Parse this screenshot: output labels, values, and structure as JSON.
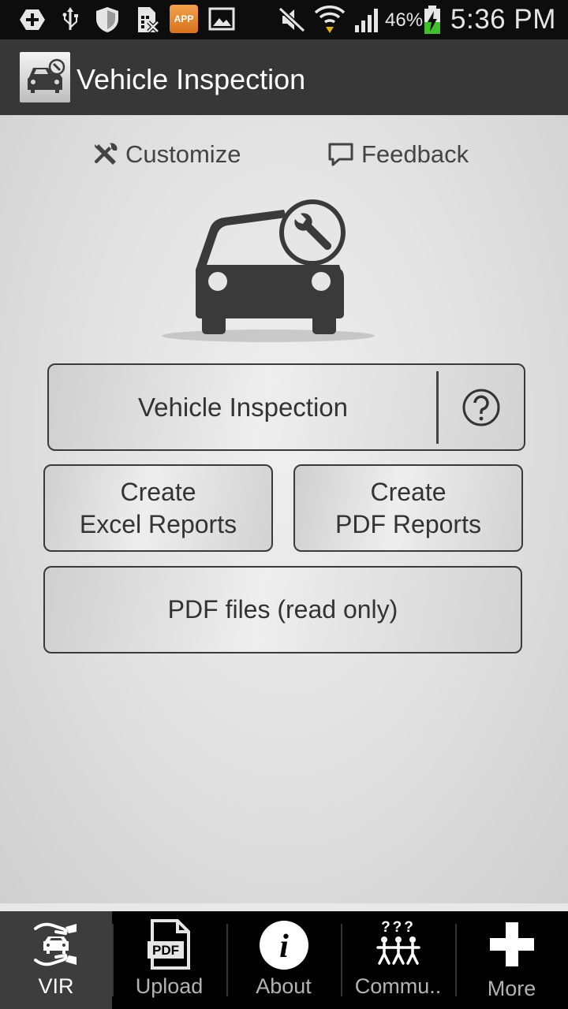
{
  "status_bar": {
    "battery_percent": "46%",
    "time": "5:36 PM",
    "icons": [
      "add-icon",
      "usb-icon",
      "shield-icon",
      "sim-icon",
      "app-icon",
      "image-icon",
      "mute-icon",
      "wifi-icon",
      "signal-icon",
      "battery-charging-icon"
    ],
    "app_icon_text": "APP"
  },
  "app_bar": {
    "title": "Vehicle Inspection",
    "logo_icon": "car-wrench-icon"
  },
  "links": {
    "customize": "Customize",
    "feedback": "Feedback"
  },
  "hero_icon": "car-wrench-icon",
  "buttons": {
    "vehicle_inspection": "Vehicle Inspection",
    "excel_line1": "Create",
    "excel_line2": "Excel Reports",
    "pdf_line1": "Create",
    "pdf_line2": "PDF Reports",
    "pdf_files": "PDF files (read only)",
    "help_icon": "question-icon"
  },
  "bottom_nav": {
    "items": [
      {
        "label": "VIR",
        "icon": "vir-hands-car-icon",
        "active": true
      },
      {
        "label": "Upload",
        "icon": "pdf-file-icon",
        "icon_text": "PDF"
      },
      {
        "label": "About",
        "icon": "info-icon",
        "icon_text": "i"
      },
      {
        "label": "Commu..",
        "icon": "community-icon",
        "icon_text": "???"
      },
      {
        "label": "More",
        "icon": "plus-icon"
      }
    ]
  },
  "colors": {
    "app_bar": "#373737",
    "status_bar": "#0d0d0d",
    "button_border": "#3a3a3a",
    "text_dark": "#333333",
    "nav_active": "#3d3d3d"
  }
}
